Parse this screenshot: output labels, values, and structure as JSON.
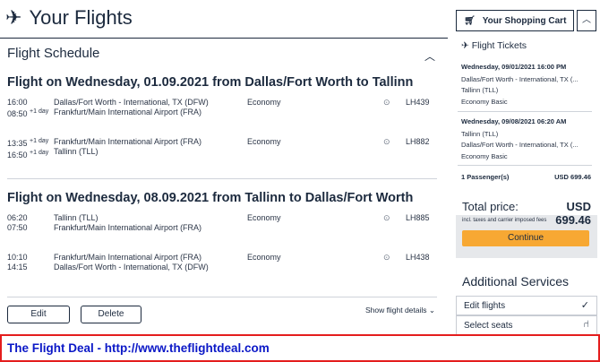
{
  "header": {
    "title": "Your Flights",
    "plane_icon": "airplane-icon"
  },
  "schedule": {
    "title": "Flight Schedule",
    "outbound": {
      "title": "Flight on Wednesday, 01.09.2021 from Dallas/Fort Worth to Tallinn",
      "segments": [
        {
          "dep_time": "16:00",
          "arr_time": "08:50",
          "arr_offset": "+1 day",
          "from": "Dallas/Fort Worth - International, TX (DFW)",
          "to": "Frankfurt/Main International Airport (FRA)",
          "cabin": "Economy",
          "flight_no": "LH439"
        },
        {
          "dep_time": "13:35",
          "dep_offset": "+1 day",
          "arr_time": "16:50",
          "arr_offset": "+1 day",
          "from": "Frankfurt/Main International Airport (FRA)",
          "to": "Tallinn (TLL)",
          "cabin": "Economy",
          "flight_no": "LH882"
        }
      ]
    },
    "inbound": {
      "title": "Flight on Wednesday, 08.09.2021 from Tallinn to Dallas/Fort Worth",
      "segments": [
        {
          "dep_time": "06:20",
          "arr_time": "07:50",
          "from": "Tallinn (TLL)",
          "to": "Frankfurt/Main International Airport (FRA)",
          "cabin": "Economy",
          "flight_no": "LH885"
        },
        {
          "dep_time": "10:10",
          "arr_time": "14:15",
          "from": "Frankfurt/Main International Airport (FRA)",
          "to": "Dallas/Fort Worth - International, TX (DFW)",
          "cabin": "Economy",
          "flight_no": "LH438"
        }
      ]
    },
    "edit_label": "Edit",
    "delete_label": "Delete",
    "details_label": "Show flight details"
  },
  "cart": {
    "title": "Your Shopping Cart",
    "tickets_title": "Flight Tickets",
    "out_date": "Wednesday, 09/01/2021 16:00 PM",
    "out_from": "Dallas/Fort Worth - International, TX (...",
    "out_to": "Tallinn (TLL)",
    "out_fare": "Economy Basic",
    "in_date": "Wednesday, 09/08/2021 06:20 AM",
    "in_from": "Tallinn (TLL)",
    "in_to": "Dallas/Fort Worth - International, TX (...",
    "in_fare": "Economy Basic",
    "passengers": "1 Passenger(s)",
    "passengers_price": "USD 699.46",
    "total_label": "Total price:",
    "total_value": "USD 699.46",
    "total_note": "incl. taxes and carrier imposed fees",
    "continue_label": "Continue"
  },
  "services": {
    "title": "Additional Services",
    "items": [
      {
        "label": "Edit flights",
        "icon": "checkmark-icon"
      },
      {
        "label": "Select seats",
        "icon": "seat-icon"
      }
    ]
  },
  "banner": {
    "text": "The Flight Deal - http://www.theflightdeal.com"
  },
  "colors": {
    "navy": "#1c2a3e",
    "accent": "#f7a833",
    "banner_border": "#e41d1d",
    "banner_text": "#0b18c7"
  }
}
